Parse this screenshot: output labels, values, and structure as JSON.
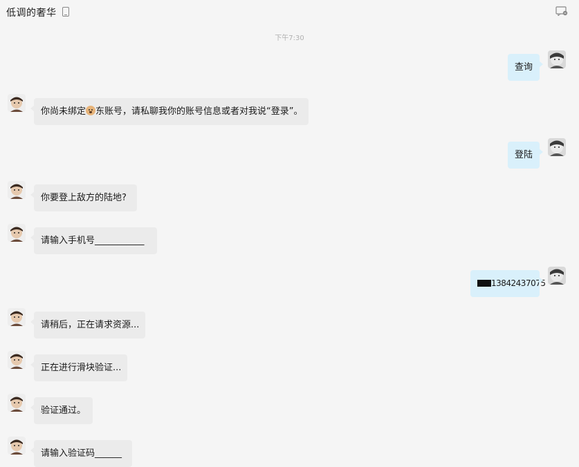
{
  "header": {
    "title": "低调的奢华",
    "icons": [
      "phone-icon",
      "chat-bubble-icon"
    ]
  },
  "timestamp": "下午7:30",
  "messages": [
    {
      "side": "right",
      "text": "查询"
    },
    {
      "side": "left",
      "text_before": "你尚未绑定",
      "emoji": "dog-face-icon",
      "text_after": "东账号，请私聊我你的账号信息或者对我说“登录”。"
    },
    {
      "side": "right",
      "text": "登陆"
    },
    {
      "side": "left",
      "text": "你要登上敌方的陆地?"
    },
    {
      "side": "left",
      "text": "请输入手机号___________"
    },
    {
      "side": "right",
      "text_before": "",
      "text_after": "13842437075",
      "redacted": true
    },
    {
      "side": "left",
      "text": "请稍后，正在请求资源..."
    },
    {
      "side": "left",
      "text": "正在进行滑块验证..."
    },
    {
      "side": "left",
      "text": "验证通过。"
    },
    {
      "side": "left",
      "text": "请输入验证码______"
    }
  ],
  "colors": {
    "background": "#f5f5f5",
    "left_bubble": "#ebebeb",
    "right_bubble": "#d9f0fb",
    "timestamp": "#b0b0b0"
  }
}
